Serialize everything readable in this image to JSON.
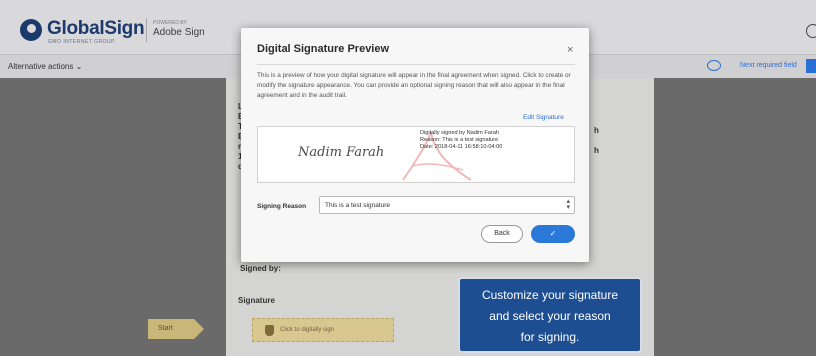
{
  "header": {
    "brand": "GlobalSign",
    "brand_tagline": "GMO INTERNET GROUP",
    "powered_by": "POWERED BY",
    "product": "Adobe Sign"
  },
  "toolbar": {
    "alternative_actions": "Alternative actions ⌄",
    "next_required_field": "Next required field"
  },
  "document": {
    "fragments": [
      "Le",
      "B",
      "Ty",
      "B",
      "m",
      "11",
      "de"
    ],
    "right_fragments": [
      "h",
      "h"
    ],
    "signed_by_label": "Signed by:",
    "signature_label": "Signature",
    "signature_field_text": "Click to digitally sign",
    "start_tag": "Start"
  },
  "modal": {
    "title": "Digital Signature Preview",
    "close": "×",
    "description": "This is a preview of how your digital signature will appear in the final agreement when signed. Click to create or modify the signature appearance. You can provide an optional signing reason that will also appear in the final agreement and in the audit trail.",
    "edit_signature": "Edit Signature",
    "signature_name": "Nadim Farah",
    "digitally_signed": "Digitally signed by Nadim Farah",
    "reason_line": "Reason: This is a test signature",
    "date_line": "Date: 2018-04-11 16:58:10-04:00",
    "signing_reason_label": "Signing Reason",
    "signing_reason_value": "This is a test signature",
    "back_label": "Back",
    "confirm_label": "✓"
  },
  "callout": {
    "line1": "Customize your signature",
    "line2": "and select your reason",
    "line3": "for signing."
  },
  "colors": {
    "accent": "#2a78d8",
    "brand": "#1b3a6b",
    "callout_bg": "#1d4e91",
    "signature_field": "#d8c890"
  }
}
